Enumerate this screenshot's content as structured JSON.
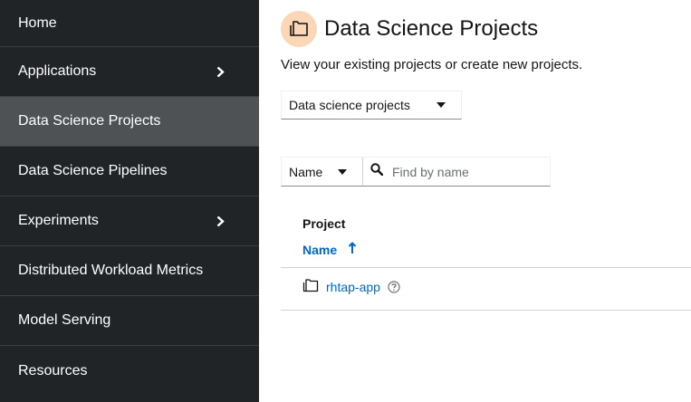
{
  "sidebar": {
    "items": [
      {
        "label": "Home",
        "has_submenu": false,
        "active": false
      },
      {
        "label": "Applications",
        "has_submenu": true,
        "active": false
      },
      {
        "label": "Data Science Projects",
        "has_submenu": false,
        "active": true
      },
      {
        "label": "Data Science Pipelines",
        "has_submenu": false,
        "active": false
      },
      {
        "label": "Experiments",
        "has_submenu": true,
        "active": false
      },
      {
        "label": "Distributed Workload Metrics",
        "has_submenu": false,
        "active": false
      },
      {
        "label": "Model Serving",
        "has_submenu": false,
        "active": false
      },
      {
        "label": "Resources",
        "has_submenu": false,
        "active": false
      }
    ]
  },
  "header": {
    "title": "Data Science Projects",
    "description": "View your existing projects or create new projects.",
    "icon": "project-folder-icon",
    "icon_bg": "#fbd6b7"
  },
  "project_type_dropdown": {
    "selected": "Data science projects"
  },
  "filter": {
    "attribute": "Name",
    "placeholder": "Find by name"
  },
  "table": {
    "group_header": "Project",
    "column_name": "Name",
    "sort_direction": "ascending",
    "rows": [
      {
        "name": "rhtap-app"
      }
    ]
  },
  "colors": {
    "sidebar_bg": "#212427",
    "sidebar_active": "#4f5255",
    "link": "#0066cc"
  }
}
